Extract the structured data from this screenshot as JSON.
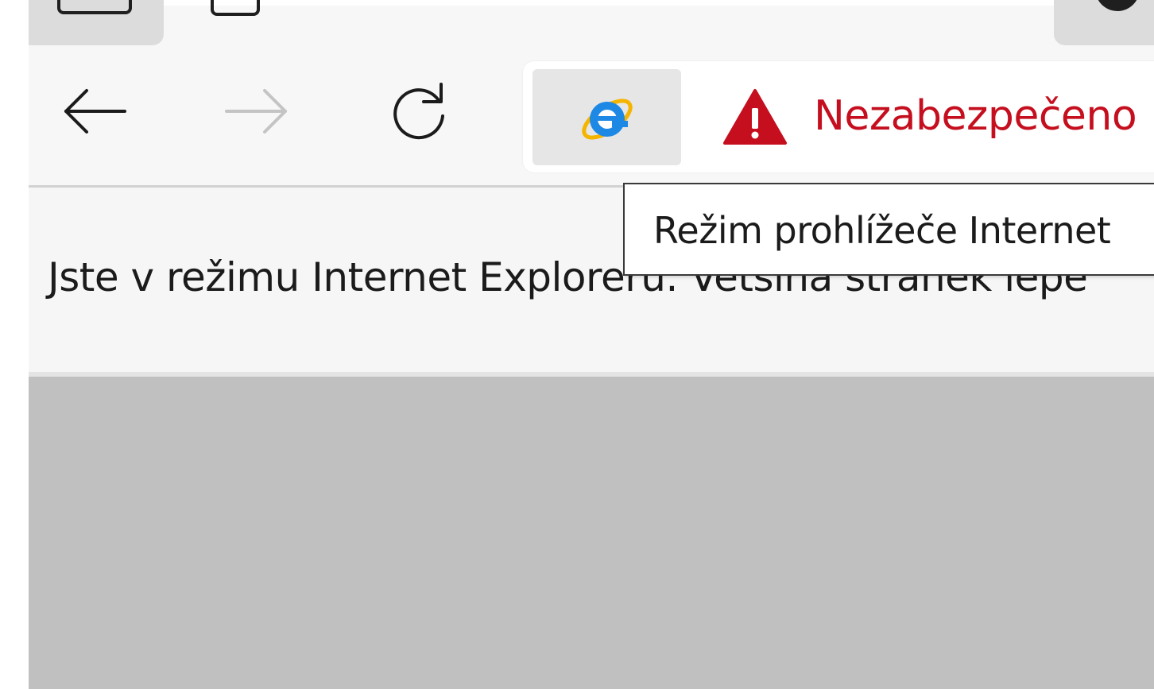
{
  "toolbar": {
    "back_icon": "arrow-left-icon",
    "forward_icon": "arrow-right-icon",
    "refresh_icon": "refresh-icon",
    "ie_mode_icon": "internet-explorer-icon"
  },
  "address_bar": {
    "security_icon": "warning-triangle-icon",
    "security_text": "Nezabezpečeno",
    "security_color": "#c50f1f"
  },
  "tooltip": {
    "text": "Režim prohlížeče Internet"
  },
  "infobar": {
    "message": "Jste v režimu Internet Exploreru. Většina stránek lépe"
  },
  "colors": {
    "toolbar_bg": "#f7f7f7",
    "content_bg": "#c0c0c0",
    "accent_ie": "#1e88e5"
  }
}
